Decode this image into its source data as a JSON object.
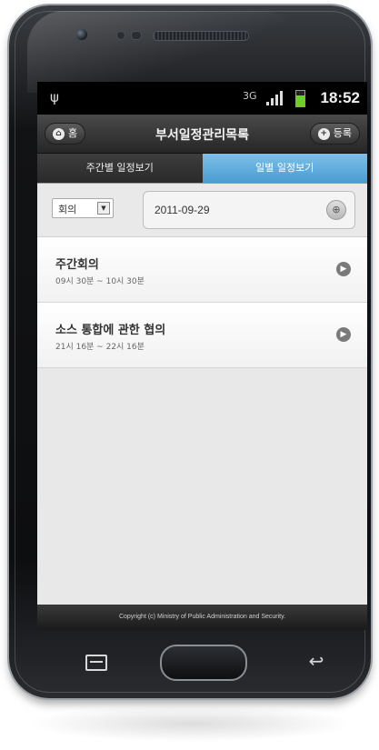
{
  "status_bar": {
    "network": "3G",
    "time": "18:52"
  },
  "header": {
    "title": "부서일정관리목록",
    "home_label": "홈",
    "add_label": "등록"
  },
  "tabs": [
    {
      "label": "주간별 일정보기",
      "active": false
    },
    {
      "label": "일별 일정보기",
      "active": true
    }
  ],
  "filters": {
    "type_select": "회의",
    "date": "2011-09-29"
  },
  "schedule": [
    {
      "title": "주간회의",
      "time": "09시 30분 ~ 10시 30분"
    },
    {
      "title": "소스 통합에 관한 협의",
      "time": "21시 16분 ~ 22시 16분"
    }
  ],
  "footer": {
    "copyright": "Copyright (c) Ministry of Public Administration and Security."
  },
  "colors": {
    "active_tab": "#4a9cd2",
    "header": "#262626",
    "battery": "#6fcf2a"
  }
}
